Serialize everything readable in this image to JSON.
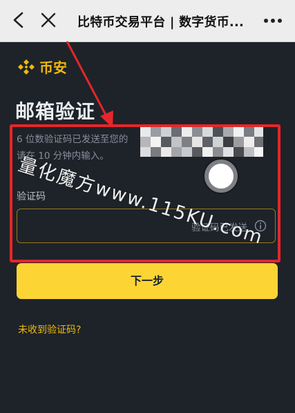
{
  "top_bar": {
    "title": "比特币交易平台 | 数字货币...",
    "back_icon": "chevron-left-icon",
    "close_icon": "close-icon",
    "more_icon": "more-dots-icon"
  },
  "brand": {
    "name": "币安",
    "logo_icon": "binance-logo-icon",
    "color": "#f0b90b"
  },
  "page": {
    "title": "邮箱验证",
    "desc_line1": "6 位数验证码已发送至您的",
    "desc_line2": "请在 10 分钟内输入。"
  },
  "code_field": {
    "label": "验证码",
    "value": "",
    "placeholder": "",
    "status": "验证码已发送",
    "info_icon": "info-circle-icon",
    "border_color": "#9a7a1a"
  },
  "actions": {
    "next_label": "下一步",
    "next_color": "#fcd535",
    "resend_label": "未收到验证码?"
  },
  "watermark": {
    "text": "量化魔方www.115KU.com"
  },
  "colors": {
    "background": "#1e2329",
    "annotation_red": "#e5262a"
  }
}
